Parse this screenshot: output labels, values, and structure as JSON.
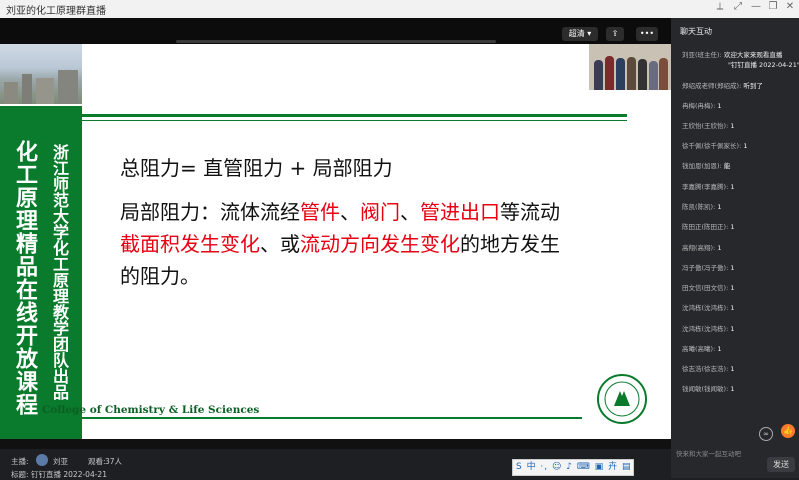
{
  "window": {
    "title": "刘亚的化工原理群直播"
  },
  "player": {
    "quality": "超清",
    "more": "•••"
  },
  "slide": {
    "vertical_title": "化工原理精品在线开放课程",
    "vertical_subtitle": "浙江师范大学化工原理教学团队出品",
    "college": "College of Chemistry & Life Sciences",
    "line1": "总阻力= 直管阻力 + 局部阻力",
    "p_a": "局部阻力：流体流经",
    "p_b": "管件",
    "p_c": "、",
    "p_d": "阀门",
    "p_e": "、",
    "p_f": "管进出口",
    "p_g": "等流动",
    "p_h": "截面积发生变化",
    "p_i": "、或",
    "p_j": "流动方向发生变化",
    "p_k": "的地方发生",
    "p_l": "的阻力。"
  },
  "host": {
    "label": "主播:",
    "name": "刘亚",
    "viewers_label": "观看:",
    "viewers": "37人",
    "subject_label": "标题:",
    "subject": "钉钉直播 2022-04-21"
  },
  "ime": {
    "text": "S 中 ·, ☺ ♪ ⌨ ▣ 卉 ▤"
  },
  "chat": {
    "title": "聊天互动",
    "messages": [
      {
        "name": "刘亚(班主任):",
        "text": "欢迎大家来观看直播",
        "text2": "\"钉钉直播 2022-04-21\"。"
      },
      {
        "name": "郑绍成老师(郑绍成):",
        "text": "听到了"
      },
      {
        "name": "冉梅(冉梅):",
        "text": "1"
      },
      {
        "name": "王欣怡(王欣怡):",
        "text": "1"
      },
      {
        "name": "徐千佩(徐千佩家长):",
        "text": "1"
      },
      {
        "name": "钱加恩(加恩):",
        "text": "能"
      },
      {
        "name": "李嘉腾(李嘉腾):",
        "text": "1"
      },
      {
        "name": "陈凯(陈凯):",
        "text": "1"
      },
      {
        "name": "陈田正(陈田正):",
        "text": "1"
      },
      {
        "name": "高翔(高翔):",
        "text": "1"
      },
      {
        "name": "冯子傲(冯子傲):",
        "text": "1"
      },
      {
        "name": "田文信(田文信):",
        "text": "1"
      },
      {
        "name": "沈鸿栋(沈鸿栋):",
        "text": "1"
      },
      {
        "name": "沈鸿栋(沈鸿栋):",
        "text": "1"
      },
      {
        "name": "高曦(高曦):",
        "text": "1"
      },
      {
        "name": "徐志浩(徐志浩):",
        "text": "1"
      },
      {
        "name": "钱闻敏(钱闻敏):",
        "text": "1"
      }
    ],
    "input_placeholder": "快来和大家一起互动吧",
    "send": "发送"
  }
}
